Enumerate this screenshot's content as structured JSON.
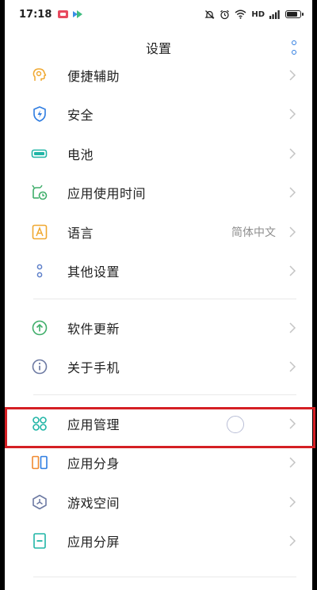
{
  "status_bar": {
    "time": "17:18",
    "network": "HD"
  },
  "header": {
    "title": "设置"
  },
  "colors": {
    "accent": "#2f7de1",
    "highlight": "#d51f24",
    "text": "#1f1f1f",
    "secondary_text": "#8e8e8e"
  },
  "list": {
    "group1": [
      {
        "label": "便捷辅助",
        "icon": "head-bulb-icon"
      },
      {
        "label": "安全",
        "icon": "shield-icon"
      },
      {
        "label": "电池",
        "icon": "battery-icon"
      },
      {
        "label": "应用使用时间",
        "icon": "app-timer-icon"
      },
      {
        "label": "语言",
        "icon": "language-icon",
        "value": "简体中文"
      },
      {
        "label": "其他设置",
        "icon": "dots-icon"
      }
    ],
    "group2": [
      {
        "label": "软件更新",
        "icon": "update-icon"
      },
      {
        "label": "关于手机",
        "icon": "info-icon"
      }
    ],
    "group3": [
      {
        "label": "应用管理",
        "icon": "app-grid-icon"
      },
      {
        "label": "应用分身",
        "icon": "app-clone-icon"
      },
      {
        "label": "游戏空间",
        "icon": "game-space-icon"
      },
      {
        "label": "应用分屏",
        "icon": "split-screen-icon"
      }
    ]
  }
}
